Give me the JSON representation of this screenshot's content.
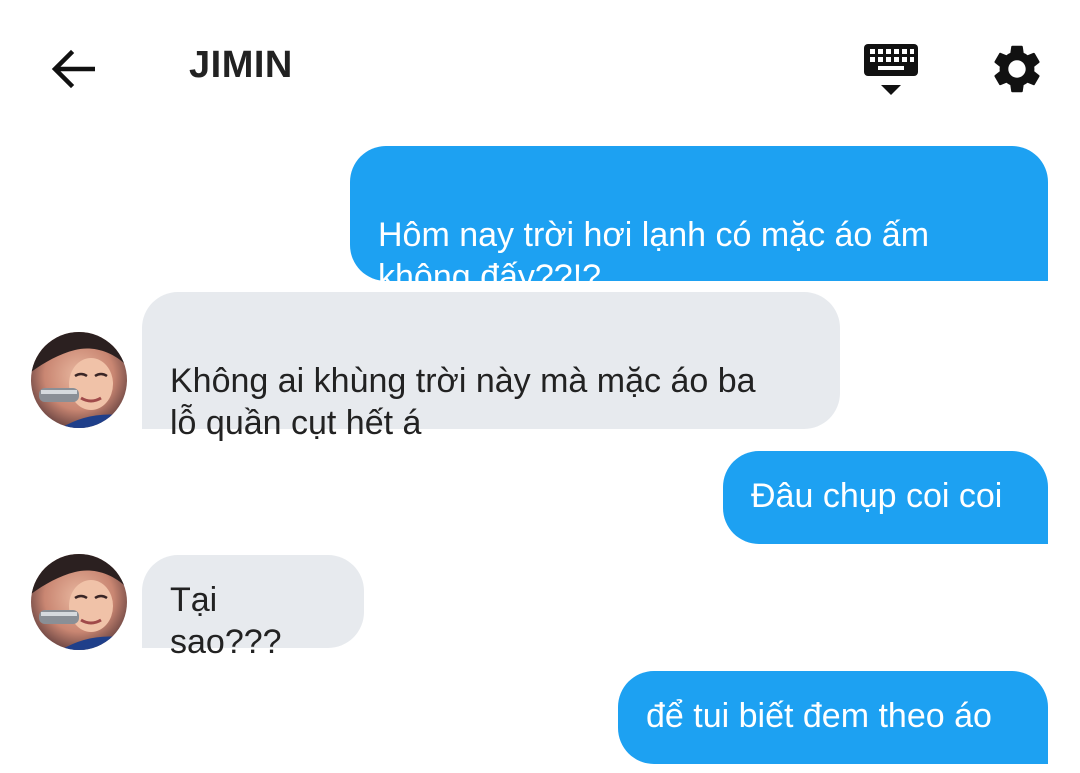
{
  "header": {
    "title": "JIMIN",
    "back_icon": "arrow-left-icon",
    "keyboard_icon": "keyboard-hide-icon",
    "settings_icon": "gear-icon"
  },
  "colors": {
    "outgoing_bubble": "#1da1f2",
    "incoming_bubble": "#e7eaee",
    "incoming_text": "#222222",
    "outgoing_text": "#ffffff"
  },
  "messages": [
    {
      "direction": "out",
      "text": "Hôm nay trời hơi lạnh có mặc áo ấm\nkhông đấy??!?"
    },
    {
      "direction": "in",
      "text": "Không ai khùng trời này mà mặc áo ba\nlỗ quần cụt hết á"
    },
    {
      "direction": "out",
      "text": "Đâu chụp coi coi"
    },
    {
      "direction": "in",
      "text": "Tại sao???"
    },
    {
      "direction": "out",
      "text": "để tui biết đem theo áo"
    }
  ]
}
